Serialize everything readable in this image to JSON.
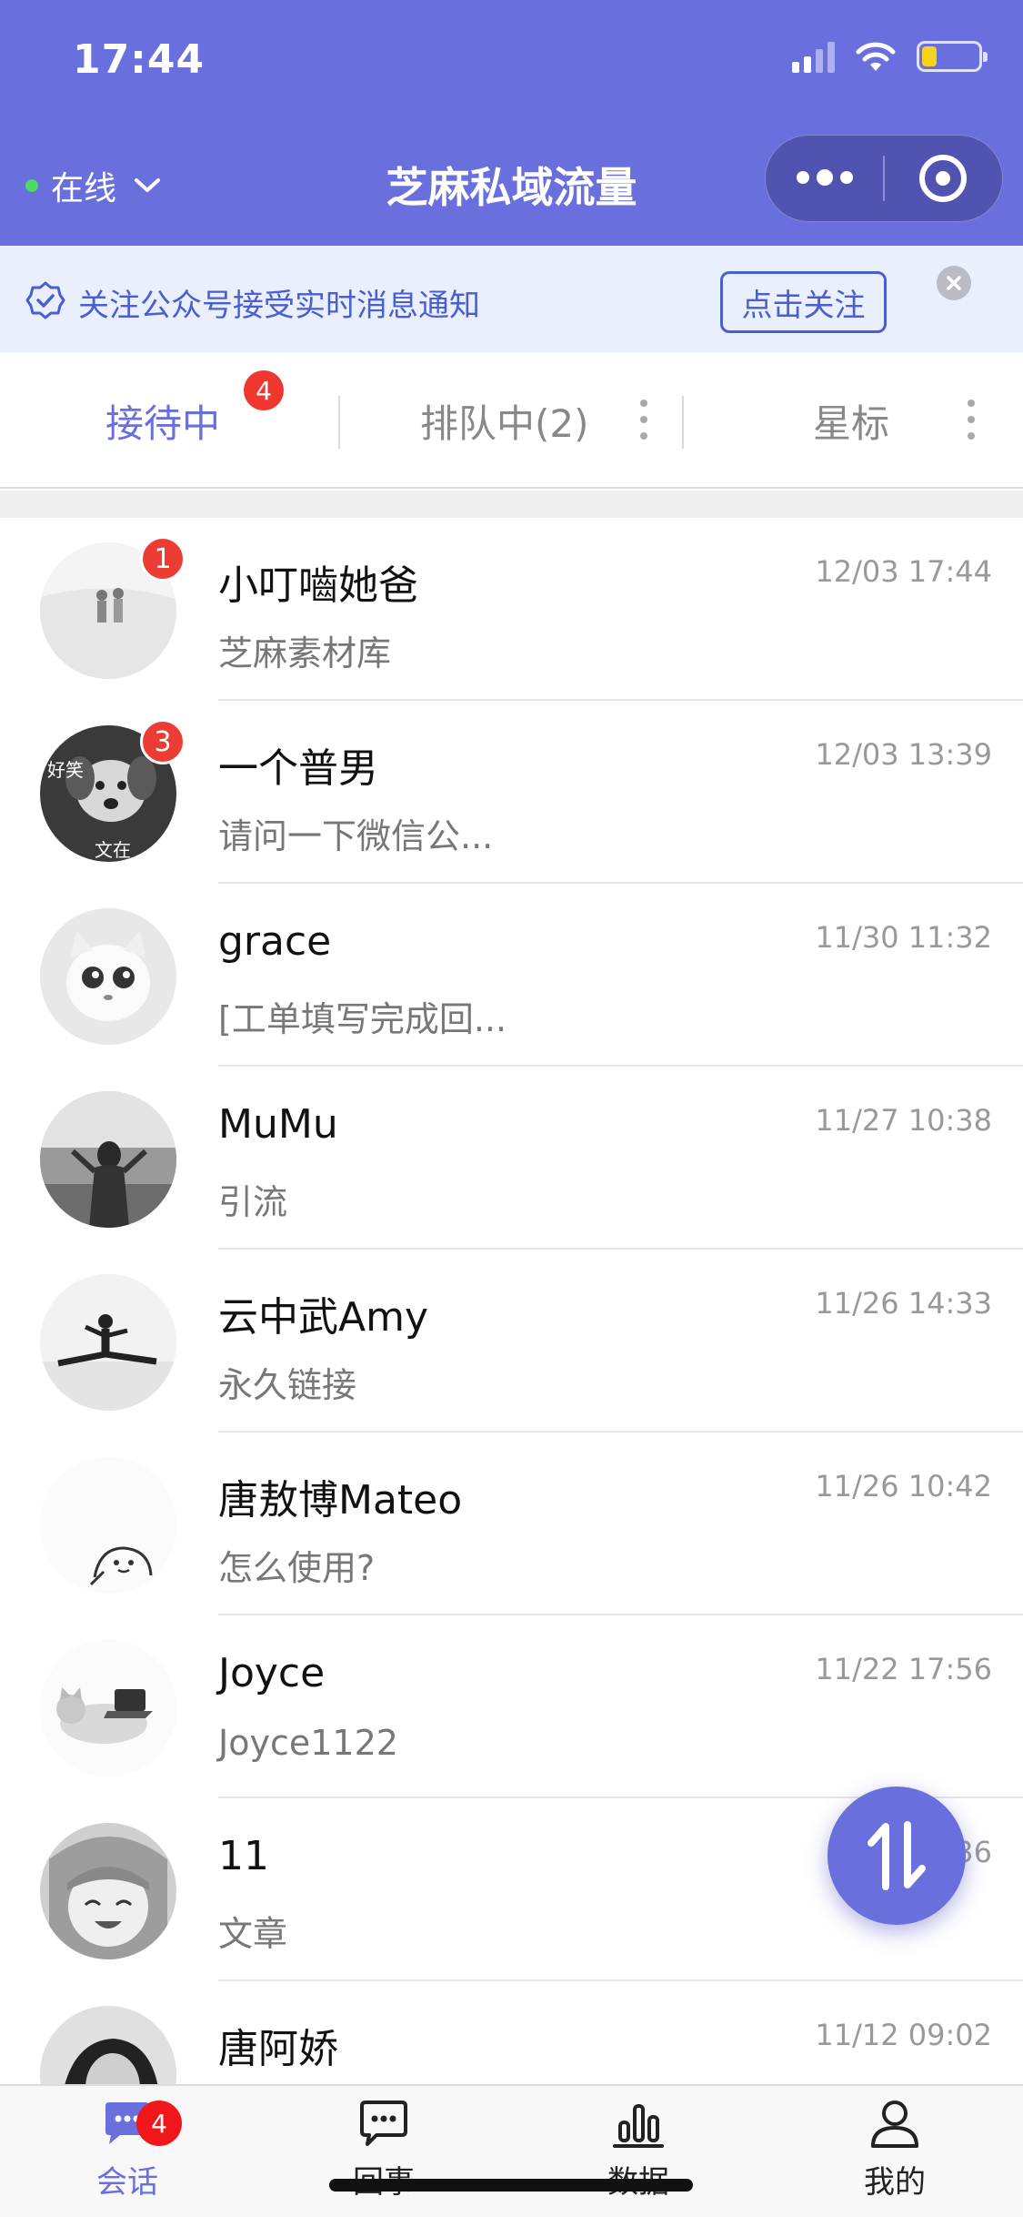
{
  "status_bar": {
    "time": "17:44",
    "battery_level": 0.26
  },
  "header": {
    "status_label": "在线",
    "title": "芝麻私域流量"
  },
  "notice": {
    "text": "关注公众号接受实时消息通知",
    "button_label": "点击关注"
  },
  "tabs": [
    {
      "label": "接待中",
      "badge": "4",
      "active": true
    },
    {
      "label": "排队中(2)",
      "active": false
    },
    {
      "label": "星标",
      "active": false
    }
  ],
  "conversations": [
    {
      "name": "小叮嚙她爸",
      "time": "12/03 17:44",
      "preview": "芝麻素材库",
      "badge": "1",
      "avatar": "beach-walk-avatar"
    },
    {
      "name": "一个普男",
      "time": "12/03 13:39",
      "preview": "请问一下微信公...",
      "badge": "3",
      "avatar": "dog-avatar",
      "avatar_text_1": "好笑",
      "avatar_text_2": "文在"
    },
    {
      "name": "grace",
      "time": "11/30 11:32",
      "preview": "[工单填写完成回...",
      "avatar": "cat-avatar"
    },
    {
      "name": "MuMu",
      "time": "11/27 10:38",
      "preview": "引流",
      "avatar": "girl-sea-avatar"
    },
    {
      "name": "云中武Amy",
      "time": "11/26 14:33",
      "preview": "永久链接",
      "avatar": "split-pose-avatar"
    },
    {
      "name": "唐敖博Mateo",
      "time": "11/26 10:42",
      "preview": "怎么使用?",
      "avatar": "doodle-avatar"
    },
    {
      "name": "Joyce",
      "time": "11/22 17:56",
      "preview": "Joyce1122",
      "avatar": "laptop-cat-avatar"
    },
    {
      "name": "11",
      "time": "36",
      "preview": "文章",
      "avatar": "anime-avatar"
    },
    {
      "name": "唐阿娇",
      "time": "11/12 09:02",
      "preview": "",
      "avatar": "portrait-avatar"
    }
  ],
  "bottom_nav": [
    {
      "label": "会话",
      "badge": "4",
      "icon": "chat-icon",
      "active": true
    },
    {
      "label": "回事",
      "icon": "message-icon",
      "active": false
    },
    {
      "label": "数据",
      "icon": "bar-chart-icon",
      "active": false
    },
    {
      "label": "我的",
      "icon": "person-icon",
      "active": false
    }
  ],
  "colors": {
    "brand": "#6a6fde",
    "badge_red": "#ec3d35",
    "notice_bg": "#e9effc",
    "notice_text": "#4a5ed1"
  }
}
